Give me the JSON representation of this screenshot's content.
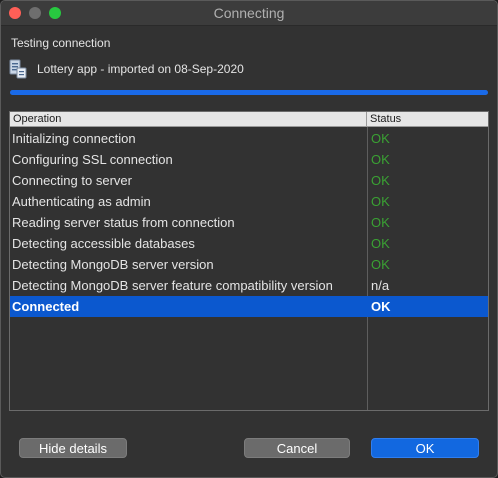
{
  "window": {
    "title": "Connecting"
  },
  "header": {
    "subtitle": "Testing connection",
    "connection_name": "Lottery app - imported on 08-Sep-2020",
    "connection_icon": "database-doc-icon"
  },
  "progress": {
    "fraction": 1.0
  },
  "table": {
    "columns": [
      "Operation",
      "Status"
    ],
    "rows": [
      {
        "operation": "Initializing connection",
        "status": "OK",
        "kind": "ok"
      },
      {
        "operation": "Configuring SSL connection",
        "status": "OK",
        "kind": "ok"
      },
      {
        "operation": "Connecting to server",
        "status": "OK",
        "kind": "ok"
      },
      {
        "operation": "Authenticating as admin",
        "status": "OK",
        "kind": "ok"
      },
      {
        "operation": "Reading server status from connection",
        "status": "OK",
        "kind": "ok"
      },
      {
        "operation": "Detecting accessible databases",
        "status": "OK",
        "kind": "ok"
      },
      {
        "operation": "Detecting MongoDB server version",
        "status": "OK",
        "kind": "ok"
      },
      {
        "operation": "Detecting MongoDB server feature compatibility version",
        "status": "n/a",
        "kind": "na"
      },
      {
        "operation": "Connected",
        "status": "OK",
        "kind": "selected"
      }
    ]
  },
  "buttons": {
    "hide_details": "Hide details",
    "cancel": "Cancel",
    "ok": "OK"
  },
  "colors": {
    "accent": "#1268e0",
    "status_ok": "#3aa133",
    "selected_row": "#0b58cf"
  }
}
